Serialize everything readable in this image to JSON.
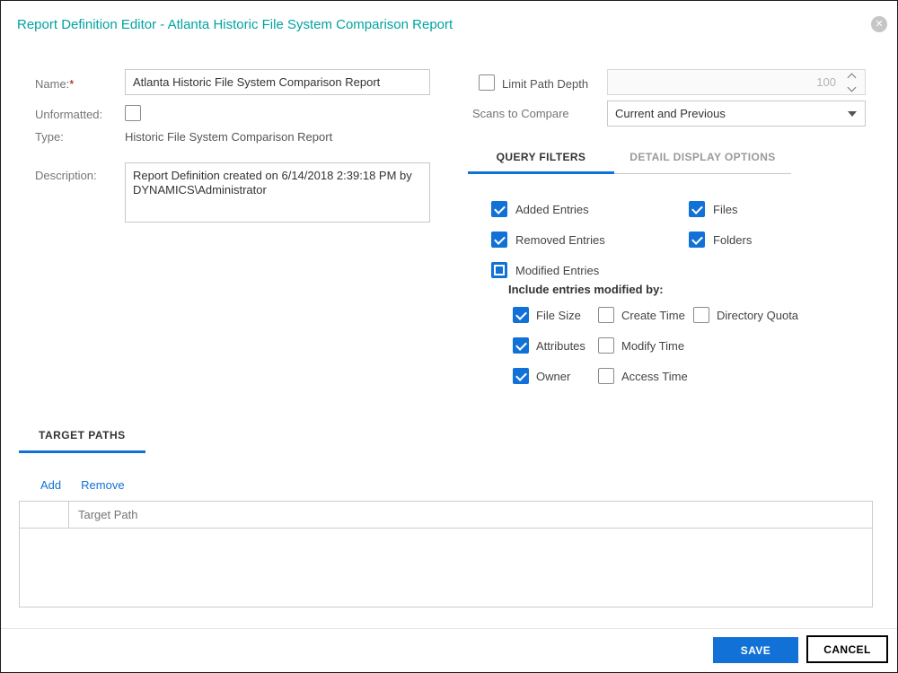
{
  "accent_color": "#1271d6",
  "title_color": "#00a3a1",
  "header": {
    "title": "Report Definition Editor - Atlanta Historic File System Comparison Report",
    "close_glyph": "✕"
  },
  "form": {
    "name_label": "Name:",
    "required_marker": "*",
    "name_value": "Atlanta Historic File System Comparison Report",
    "unformatted_label": "Unformatted:",
    "unformatted_state": "unchecked",
    "type_label": "Type:",
    "type_value": "Historic File System Comparison Report",
    "description_label": "Description:",
    "description_value": "Report Definition created on 6/14/2018 2:39:18 PM by DYNAMICS\\Administrator"
  },
  "options": {
    "limit_label": "Limit Path Depth",
    "limit_state": "unchecked",
    "depth_value": "100",
    "scans_label": "Scans to Compare",
    "scans_value": "Current and Previous"
  },
  "tabs": [
    {
      "label": "QUERY FILTERS",
      "active": true
    },
    {
      "label": "DETAIL DISPLAY OPTIONS",
      "active": false
    }
  ],
  "filters": {
    "left": [
      {
        "label": "Added Entries",
        "state": "checked"
      },
      {
        "label": "Removed Entries",
        "state": "checked"
      },
      {
        "label": "Modified Entries",
        "state": "partial"
      }
    ],
    "right": [
      {
        "label": "Files",
        "state": "checked"
      },
      {
        "label": "Folders",
        "state": "checked"
      }
    ],
    "include_label": "Include entries modified by:",
    "modified_by": [
      {
        "label": "File Size",
        "state": "checked"
      },
      {
        "label": "Create Time",
        "state": "unchecked"
      },
      {
        "label": "Directory Quota",
        "state": "unchecked"
      },
      {
        "label": "Attributes",
        "state": "checked"
      },
      {
        "label": "Modify Time",
        "state": "unchecked"
      },
      {
        "label": "Owner",
        "state": "checked"
      },
      {
        "label": "Access Time",
        "state": "unchecked"
      }
    ]
  },
  "target": {
    "tab_label": "TARGET PATHS",
    "add_label": "Add",
    "remove_label": "Remove",
    "column_header": "Target Path"
  },
  "footer": {
    "save_label": "SAVE",
    "cancel_label": "CANCEL"
  }
}
